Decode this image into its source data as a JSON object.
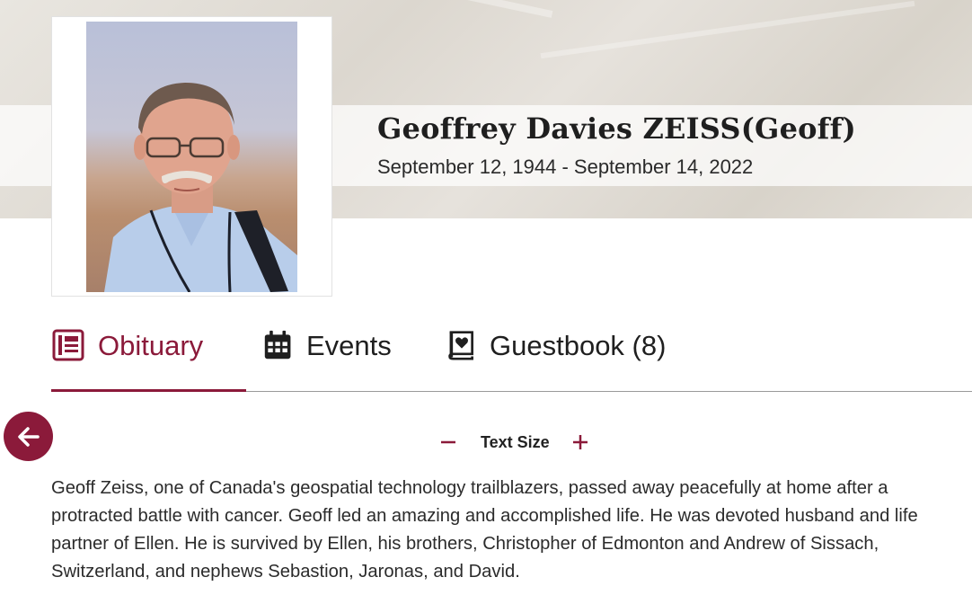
{
  "header": {
    "name": "Geoffrey Davies ZEISS(Geoff)",
    "dates": "September 12, 1944 - September 14, 2022"
  },
  "photo": {
    "alt": "Portrait of Geoffrey Davies Zeiss"
  },
  "tabs": [
    {
      "label": "Obituary",
      "icon": "obituary-icon",
      "active": true
    },
    {
      "label": "Events",
      "icon": "calendar-icon",
      "active": false
    },
    {
      "label": "Guestbook (8)",
      "icon": "guestbook-icon",
      "active": false
    }
  ],
  "text_size": {
    "label": "Text Size",
    "decrease_icon": "minus-icon",
    "increase_icon": "plus-icon"
  },
  "back_button": {
    "icon": "arrow-left-icon"
  },
  "obituary": {
    "text": "Geoff Zeiss, one of Canada's geospatial technology trailblazers, passed away peacefully at home after a protracted battle with cancer. Geoff led an amazing and accomplished life. He was devoted husband and life partner of Ellen. He is survived by Ellen, his brothers, Christopher of Edmonton and Andrew of Sissach, Switzerland, and nephews Sebastion, Jaronas, and David."
  },
  "colors": {
    "accent": "#8b1a3a",
    "text": "#222222",
    "banner": "#e4e0d9"
  }
}
